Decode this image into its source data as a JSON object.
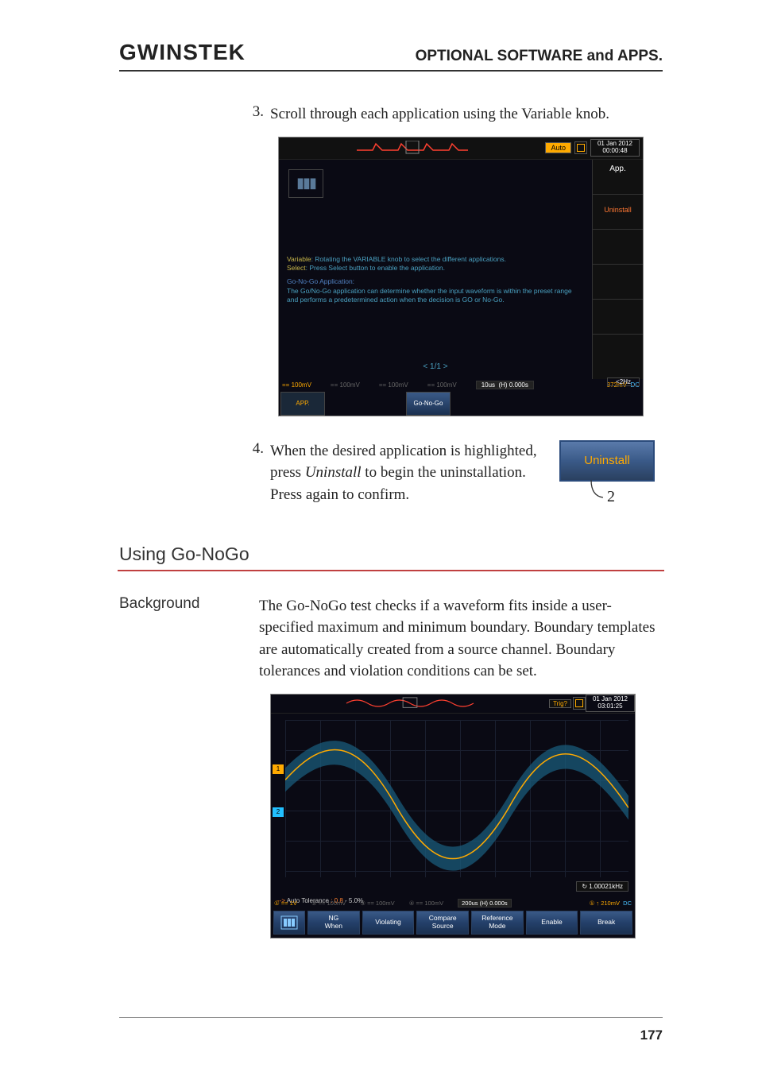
{
  "header": {
    "logo_text": "GWINSTEK",
    "title": "OPTIONAL SOFTWARE and APPS."
  },
  "step3": {
    "num": "3.",
    "text": "Scroll through each application using the Variable knob."
  },
  "scope1": {
    "auto": "Auto",
    "date_line1": "01 Jan 2012",
    "date_line2": "00:00:48",
    "side_app": "App.",
    "side_uninstall": "Uninstall",
    "variable_label": "Variable",
    "variable_text": ": Rotating the VARIABLE knob to select the different applications.",
    "select_label": "Select",
    "select_text": ": Press Select button to enable the application.",
    "app_title": "Go-No-Go Application:",
    "app_desc": "The Go/No-Go application can determine whether the input waveform is within the preset range and performs a predetermined action when the decision is GO or No-Go.",
    "page": "< 1/1 >",
    "khz": "<2Hz",
    "ch1": "== 100mV",
    "ch2": "== 100mV",
    "ch3": "== 100mV",
    "ch4": "== 100mV",
    "time": "10us",
    "trig": "0.000s",
    "right1": "372mV",
    "right2": "DC",
    "bottom_app": "APP.",
    "bottom_gonogo": "Go-No-Go"
  },
  "step4": {
    "num": "4.",
    "text_a": "When the desired application is highlighted, press ",
    "text_i": "Uninstall",
    "text_b": " to begin the uninstallation. Press again to confirm.",
    "btn_label": "Uninstall",
    "callout": "2"
  },
  "section": {
    "title": "Using Go-NoGo"
  },
  "background": {
    "label": "Background",
    "text": "The Go-NoGo test checks if a waveform fits inside a user-specified maximum and minimum boundary. Boundary templates are automatically created from a source channel. Boundary tolerances and violation conditions can be set."
  },
  "scope2": {
    "trig": "Trig?",
    "date_line1": "01 Jan 2012",
    "date_line2": "03:01:25",
    "freq": "1.00021kHz",
    "tol_a": "Auto Tolerance ",
    "tol_b": ": 0.8",
    "tol_c": " - 5.0%",
    "ch1": "1V",
    "time": "200us",
    "trigpos": "(H) 0.000s",
    "right": "210mV",
    "right2": "DC",
    "btns": {
      "ng": "NG\nWhen",
      "violating": "Violating",
      "compare": "Compare\nSource",
      "reference": "Reference\nMode",
      "enable": "Enable",
      "break": "Break"
    }
  },
  "page_number": "177"
}
